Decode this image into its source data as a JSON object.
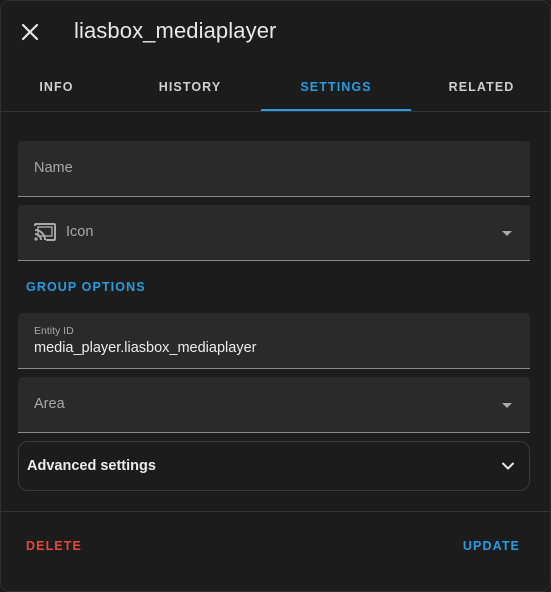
{
  "dialog": {
    "title": "liasbox_mediaplayer",
    "close_icon": "close-icon"
  },
  "tabs": [
    {
      "label": "INFO"
    },
    {
      "label": "HISTORY"
    },
    {
      "label": "SETTINGS",
      "active": true
    },
    {
      "label": "RELATED"
    }
  ],
  "form": {
    "name": {
      "label": "Name",
      "value": ""
    },
    "icon": {
      "label": "Icon",
      "icon": "cast-icon"
    },
    "group_options_label": "GROUP OPTIONS",
    "entity_id": {
      "label": "Entity ID",
      "value": "media_player.liasbox_mediaplayer"
    },
    "area": {
      "label": "Area",
      "value": ""
    },
    "advanced_settings_label": "Advanced settings"
  },
  "footer": {
    "delete_label": "DELETE",
    "update_label": "UPDATE"
  },
  "colors": {
    "accent": "#2a9be0",
    "danger": "#e8453c",
    "background": "#1c1c1c",
    "field_background": "#2a2a2a"
  }
}
